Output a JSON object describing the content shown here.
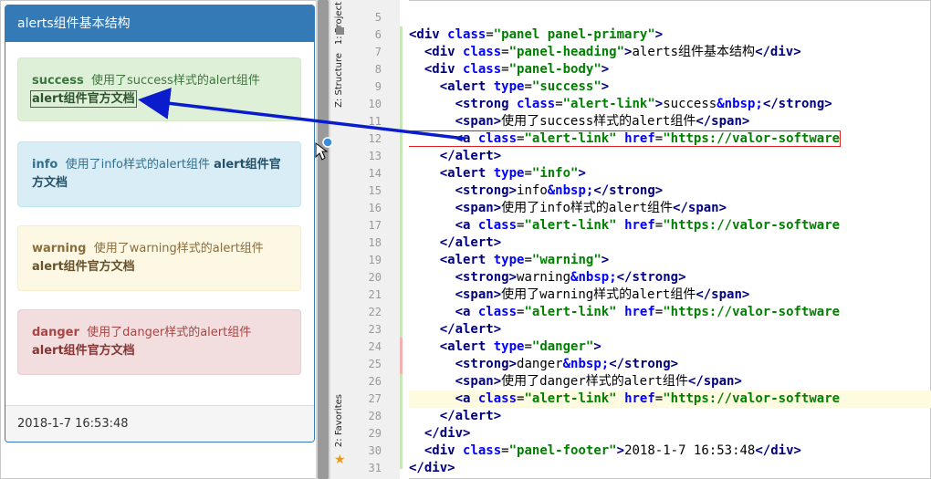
{
  "preview": {
    "heading": "alerts组件基本结构",
    "alerts": [
      {
        "type": "success",
        "strong": "success",
        "text": "使用了success样式的alert组件",
        "link": "alert组件官方文档"
      },
      {
        "type": "info",
        "strong": "info",
        "text": "使用了info样式的alert组件",
        "link": "alert组件官方文档"
      },
      {
        "type": "warning",
        "strong": "warning",
        "text": "使用了warning样式的alert组件",
        "link": "alert组件官方文档"
      },
      {
        "type": "danger",
        "strong": "danger",
        "text": "使用了danger样式的alert组件",
        "link": "alert组件官方文档"
      }
    ],
    "footer": "2018-1-7 16:53:48"
  },
  "side_tabs": {
    "project": "1: Project",
    "structure": "Z: Structure",
    "favorites": "2: Favorites"
  },
  "editor": {
    "line_numbers": [
      "5",
      "6",
      "7",
      "8",
      "9",
      "10",
      "11",
      "12",
      "13",
      "14",
      "15",
      "16",
      "17",
      "18",
      "19",
      "20",
      "21",
      "22",
      "23",
      "24",
      "25",
      "26",
      "27",
      "28",
      "29",
      "30",
      "31"
    ],
    "code_lines": [
      "",
      "<div class=\"panel panel-primary\">",
      "  <div class=\"panel-heading\">alerts组件基本结构</div>",
      "  <div class=\"panel-body\">",
      "    <alert type=\"success\">",
      "      <strong class=\"alert-link\">success&nbsp;</strong>",
      "      <span>使用了success样式的alert组件</span>",
      "      <a class=\"alert-link\" href=\"https://valor-software",
      "    </alert>",
      "    <alert type=\"info\">",
      "      <strong>info&nbsp;</strong>",
      "      <span>使用了info样式的alert组件</span>",
      "      <a class=\"alert-link\" href=\"https://valor-software",
      "    </alert>",
      "    <alert type=\"warning\">",
      "      <strong>warning&nbsp;</strong>",
      "      <span>使用了warning样式的alert组件</span>",
      "      <a class=\"alert-link\" href=\"https://valor-software",
      "    </alert>",
      "    <alert type=\"danger\">",
      "      <strong>danger&nbsp;</strong>",
      "      <span>使用了danger样式的alert组件</span>",
      "      <a class=\"alert-link\" href=\"https://valor-software",
      "    </alert>",
      "  </div>",
      "  <div class=\"panel-footer\">2018-1-7 16:53:48</div>",
      "</div>"
    ]
  },
  "colors": {
    "primary": "#337ab7",
    "arrow": "#0b1ccc",
    "highlight_box": "#e02020"
  }
}
